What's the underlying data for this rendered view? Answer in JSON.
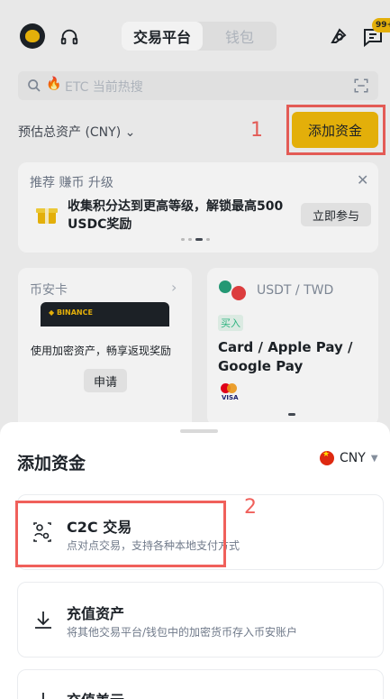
{
  "header": {
    "tab_exchange": "交易平台",
    "tab_wallet": "钱包",
    "notification_badge": "99+"
  },
  "search": {
    "placeholder": "ETC 当前热搜"
  },
  "assets": {
    "label": "预估总资产 (CNY)",
    "add_funds_button": "添加资金"
  },
  "annotations": {
    "label_1": "1",
    "label_2": "2"
  },
  "promo": {
    "header": "推荐 赚币 升级",
    "text": "收集积分达到更高等级，解锁最高500 USDC奖励",
    "join_button": "立即参与"
  },
  "binance_card": {
    "title": "币安卡",
    "card_brand": "BINANCE",
    "text": "使用加密资产，畅享返现奖励",
    "apply_button": "申请"
  },
  "p2p_card": {
    "pair": "USDT / TWD",
    "buy_tag": "买入",
    "methods": "Card / Apple Pay / Google Pay",
    "visa": "VISA"
  },
  "sheet": {
    "title": "添加资金",
    "currency": "CNY",
    "options": [
      {
        "title": "C2C 交易",
        "desc": "点对点交易，支持各种本地支付方式",
        "icon": "p2p-icon"
      },
      {
        "title": "充值资产",
        "desc": "将其他交易平台/钱包中的加密货币存入币安账户",
        "icon": "download-icon"
      },
      {
        "title": "充值美元",
        "desc": "",
        "icon": "download-icon"
      }
    ]
  },
  "colors": {
    "brand_yellow": "#f0b90b",
    "annotation_red": "#f0605b",
    "buy_green": "#2ebd85"
  }
}
